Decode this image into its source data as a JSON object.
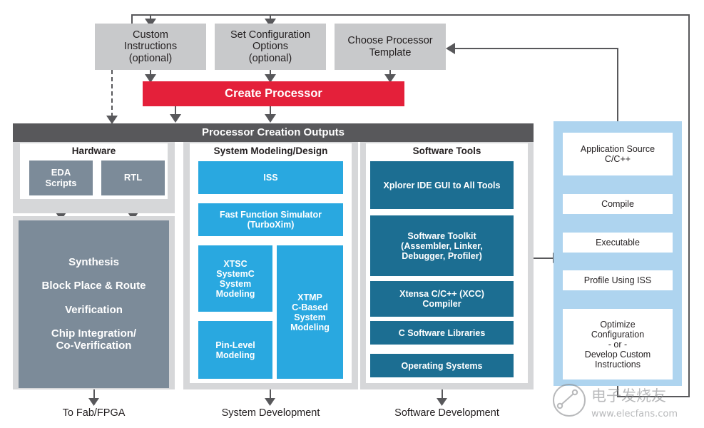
{
  "diagram": {
    "title": "Processor Creation Outputs",
    "create_action": "Create Processor",
    "inputs": [
      {
        "id": "custom-instructions",
        "line1": "Custom",
        "line2": "Instructions",
        "line3": "(optional)"
      },
      {
        "id": "set-configuration-options",
        "line1": "Set Configuration",
        "line2": "Options",
        "line3": "(optional)"
      },
      {
        "id": "choose-processor-template",
        "line1": "Choose Processor",
        "line2": "Template",
        "line3": ""
      }
    ],
    "columns": [
      {
        "id": "hardware",
        "heading": "Hardware",
        "blocks": [
          {
            "id": "eda-scripts",
            "line1": "EDA",
            "line2": "Scripts"
          },
          {
            "id": "rtl",
            "line1": "RTL",
            "line2": ""
          }
        ],
        "flow_block": {
          "id": "hardware-flow",
          "lines": [
            "Synthesis",
            "Block Place & Route",
            "Verification",
            "Chip Integration/",
            "Co-Verification"
          ]
        },
        "footer": "To Fab/FPGA"
      },
      {
        "id": "system-modeling-design",
        "heading": "System Modeling/Design",
        "blocks": [
          {
            "id": "iss",
            "lines": [
              "ISS"
            ]
          },
          {
            "id": "fast-function-simulator",
            "lines": [
              "Fast Function Simulator",
              "(TurboXim)"
            ]
          },
          {
            "id": "xtsc-systemc-system-modeling",
            "lines": [
              "XTSC",
              "SystemC",
              "System",
              "Modeling"
            ]
          },
          {
            "id": "xtmp-c-based-system-modeling",
            "lines": [
              "XTMP",
              "C-Based",
              "System",
              "Modeling"
            ]
          },
          {
            "id": "pin-level-modeling",
            "lines": [
              "Pin-Level",
              "Modeling"
            ]
          }
        ],
        "footer": "System Development"
      },
      {
        "id": "software-tools",
        "heading": "Software Tools",
        "blocks": [
          {
            "id": "xplorer-ide",
            "lines": [
              "Xplorer IDE GUI to All Tools"
            ]
          },
          {
            "id": "software-toolkit",
            "lines": [
              "Software Toolkit",
              "(Assembler, Linker,",
              "Debugger, Profiler)"
            ]
          },
          {
            "id": "xtensa-xcc-compiler",
            "lines": [
              "Xtensa C/C++ (XCC)",
              "Compiler"
            ]
          },
          {
            "id": "c-software-libraries",
            "lines": [
              "C Software Libraries"
            ]
          },
          {
            "id": "operating-systems",
            "lines": [
              "Operating Systems"
            ]
          }
        ],
        "footer": "Software Development"
      }
    ],
    "app_flow": {
      "id": "application-flow",
      "steps": [
        {
          "id": "application-source",
          "lines": [
            "Application Source",
            "C/C++"
          ]
        },
        {
          "id": "compile",
          "lines": [
            "Compile"
          ]
        },
        {
          "id": "executable",
          "lines": [
            "Executable"
          ]
        },
        {
          "id": "profile-using-iss",
          "lines": [
            "Profile Using ISS"
          ]
        },
        {
          "id": "optimize-configuration",
          "lines": [
            "Optimize",
            "Configuration",
            "- or -",
            "Develop Custom",
            "Instructions"
          ]
        }
      ]
    },
    "watermark": {
      "text": "电子发烧友",
      "url": "www.elecfans.com"
    },
    "colors": {
      "input_gray": "#c8c9cb",
      "accent_red": "#e4203a",
      "header_dark": "#58585b",
      "panel_gray": "#d6d7d9",
      "hardware_gray": "#7c8b99",
      "bright_blue": "#29a8e0",
      "dark_teal": "#1c6e92",
      "light_blue": "#aed4ef",
      "line": "#58585b"
    }
  }
}
